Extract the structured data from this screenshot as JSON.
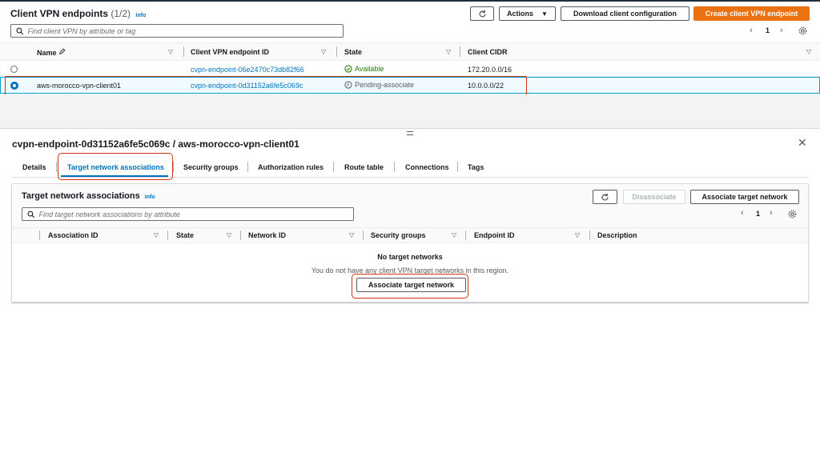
{
  "header": {
    "title": "Client VPN endpoints",
    "count": "(1/2)",
    "info": "info",
    "actions_label": "Actions",
    "download_label": "Download client configuration",
    "create_label": "Create client VPN endpoint",
    "search_placeholder": "Find client VPN by attribute or tag",
    "page_number": "1"
  },
  "endpoints_table": {
    "columns": [
      "Name",
      "Client VPN endpoint ID",
      "State",
      "Client CIDR"
    ],
    "rows": [
      {
        "name": "",
        "id": "cvpn-endpoint-06e2470c73db82f66",
        "state": "Available",
        "cidr": "172.20.0.0/16",
        "selected": false
      },
      {
        "name": "aws-morocco-vpn-client01",
        "id": "cvpn-endpoint-0d31152a6fe5c069c",
        "state": "Pending-associate",
        "cidr": "10.0.0.0/22",
        "selected": true
      }
    ]
  },
  "detail": {
    "title": "cvpn-endpoint-0d31152a6fe5c069c / aws-morocco-vpn-client01",
    "tabs": [
      "Details",
      "Target network associations",
      "Security groups",
      "Authorization rules",
      "Route table",
      "Connections",
      "Tags"
    ],
    "active_tab": "Target network associations"
  },
  "associations": {
    "title": "Target network associations",
    "info": "info",
    "disassociate_label": "Disassociate",
    "associate_label": "Associate target network",
    "search_placeholder": "Find target network associations by attribute",
    "page_number": "1",
    "columns": [
      "Association ID",
      "State",
      "Network ID",
      "Security groups",
      "Endpoint ID",
      "Description"
    ],
    "empty_title": "No target networks",
    "empty_message": "You do not have any client VPN target networks in this region.",
    "empty_button_label": "Associate target network"
  },
  "colors": {
    "primary": "#ec7211",
    "link": "#0073bb",
    "success": "#1d8102",
    "selected_row": "#f1faff",
    "highlight": "#d13212"
  },
  "icons": [
    "refresh-icon",
    "caret-down-icon",
    "search-icon",
    "chevron-left-icon",
    "chevron-right-icon",
    "gear-icon",
    "pencil-icon",
    "sort-icon",
    "check-circle-icon",
    "clock-icon",
    "close-icon",
    "drag-handle-icon"
  ]
}
